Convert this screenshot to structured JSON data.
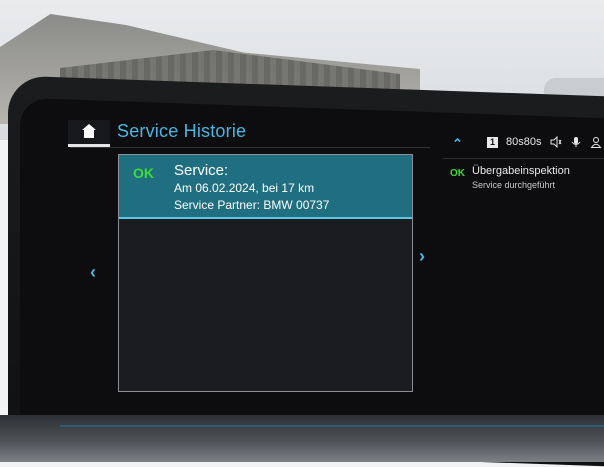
{
  "header": {
    "title": "Service Historie"
  },
  "selected_entry": {
    "status": "OK",
    "title": "Service:",
    "line1": "Am 06.02.2024, bei 17 km",
    "line2": "Service Partner: BMW 00737"
  },
  "status_bar": {
    "phone_slot": "1",
    "station_text": "80s80s"
  },
  "side_panel": {
    "status": "OK",
    "title": "Übergabeinspektion",
    "subtitle": "Service durchgeführt"
  },
  "colors": {
    "accent": "#4bb6e1",
    "ok_green": "#3fdc3a",
    "selected_bg": "#1f6f80"
  }
}
